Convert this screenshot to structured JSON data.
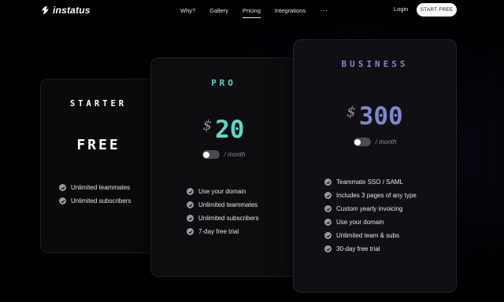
{
  "brand": {
    "name": "instatus",
    "icon": "bolt-leaf-icon"
  },
  "nav": {
    "links": [
      "Why?",
      "Gallery",
      "Pricing",
      "Integrations"
    ],
    "active": "Pricing",
    "more": "···",
    "login": "Login",
    "cta": "START FREE"
  },
  "plans": [
    {
      "name": "STARTER",
      "price_text": "FREE",
      "features": [
        "Unlimited teammates",
        "Unlimited subscribers"
      ]
    },
    {
      "name": "PRO",
      "currency": "$",
      "amount": "20",
      "period": "/ month",
      "accent": "#5fd6c6",
      "features": [
        "Use your domain",
        "Unlimited teammates",
        "Unlimited subscribers",
        "7-day free trial"
      ]
    },
    {
      "name": "BUSINESS",
      "currency": "$",
      "amount": "300",
      "period": "/ month",
      "accent": "#7f86c9",
      "features": [
        "Teammate SSO / SAML",
        "Includes 3 pages of any type",
        "Custom yearly invoicing",
        "Use your domain",
        "Unlimited team & subs",
        "30-day free trial"
      ]
    }
  ],
  "colors": {
    "background": "#000000",
    "check": "#9a9aa1",
    "toggle_off": "#4b4b52"
  }
}
